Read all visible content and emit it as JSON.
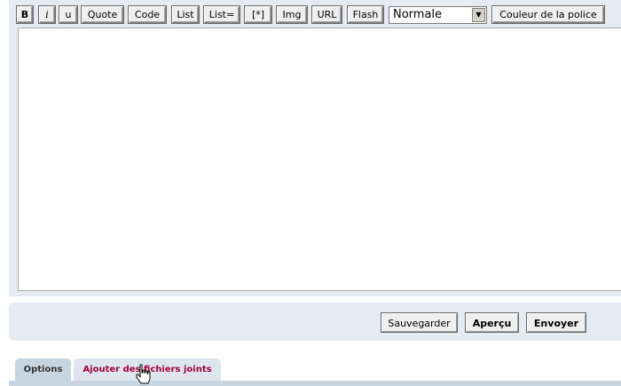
{
  "toolbar": {
    "buttons": [
      {
        "key": "bold",
        "label": "B"
      },
      {
        "key": "italic",
        "label": "i"
      },
      {
        "key": "underline",
        "label": "u"
      },
      {
        "key": "quote",
        "label": "Quote"
      },
      {
        "key": "code",
        "label": "Code"
      },
      {
        "key": "list",
        "label": "List"
      },
      {
        "key": "list-ordered",
        "label": "List="
      },
      {
        "key": "list-item",
        "label": "[*]"
      },
      {
        "key": "img",
        "label": "Img"
      },
      {
        "key": "url",
        "label": "URL"
      },
      {
        "key": "flash",
        "label": "Flash"
      }
    ],
    "size_select": {
      "value": "Normale"
    },
    "font_color_label": "Couleur de la police"
  },
  "editor": {
    "message_text": ""
  },
  "submit": {
    "save_label": "Sauvegarder",
    "preview_label": "Aperçu",
    "send_label": "Envoyer"
  },
  "tabs": [
    {
      "label": "Options"
    },
    {
      "label": "Ajouter des fichiers joints"
    }
  ],
  "colors": {
    "panel_bg": "#e4ebf2",
    "tab_active_bg": "#c7d5e1",
    "tab_link_color": "#a5003a"
  },
  "icons": {
    "cursor": "hand-pointer-icon"
  }
}
